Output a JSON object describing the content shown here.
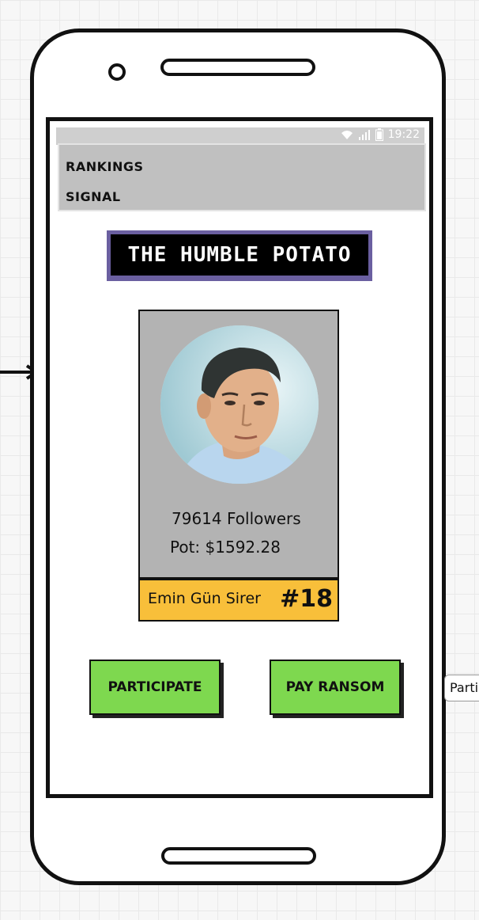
{
  "status_bar": {
    "time": "19:22"
  },
  "menu": {
    "items": [
      {
        "label": "RANKINGS"
      },
      {
        "label": "SIGNAL"
      }
    ]
  },
  "title": "THE HUMBLE POTATO",
  "profile": {
    "followers": "79614 Followers",
    "pot": "Pot: $1592.28",
    "name": "Emin Gün Sirer",
    "rank": "#18"
  },
  "buttons": {
    "participate": "PARTICIPATE",
    "pay_ransom": "PAY RANSOM"
  },
  "tooltip": {
    "text": "Parti"
  },
  "colors": {
    "title_border": "#6a5fa0",
    "card_bg": "#b3b3b3",
    "name_bar": "#f8bf3a",
    "button": "#7ed84f",
    "menu_bg": "#c0c0c0"
  }
}
